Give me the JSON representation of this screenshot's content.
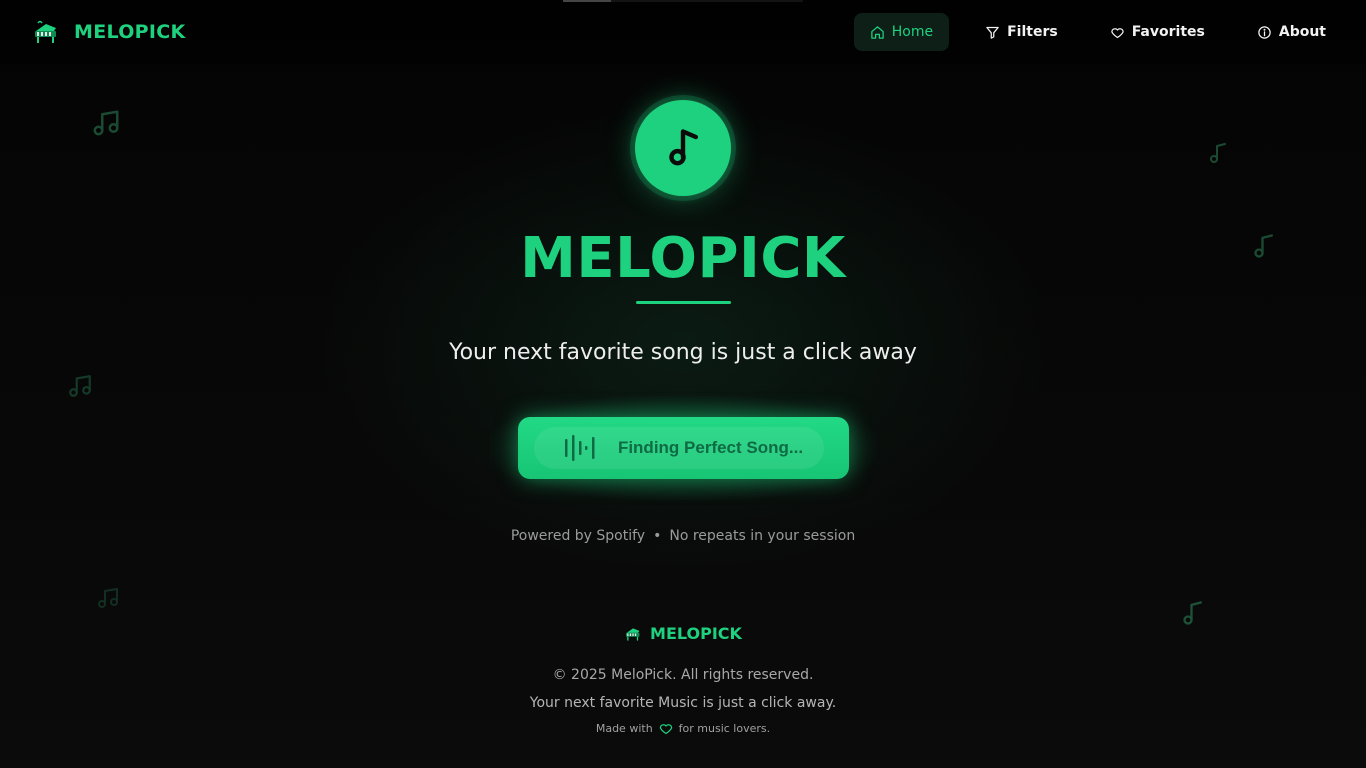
{
  "colors": {
    "accent": "#1ed17e",
    "background": "#050505",
    "button_text": "#0f6b43"
  },
  "top_progress": 0.2,
  "navbar": {
    "brand": "MELOPICK",
    "brand_icon": "piano-logo-icon",
    "items": [
      {
        "label": "Home",
        "icon": "home-icon",
        "active": true
      },
      {
        "label": "Filters",
        "icon": "filter-icon",
        "active": false
      },
      {
        "label": "Favorites",
        "icon": "heart-icon",
        "active": false
      },
      {
        "label": "About",
        "icon": "info-icon",
        "active": false
      }
    ]
  },
  "hero": {
    "icon": "music-note-icon",
    "title": "MELOPICK",
    "tagline": "Your next favorite song is just a click away",
    "button_label": "Finding Perfect Song...",
    "button_icon": "audio-wave-icon",
    "meta_left": "Powered by Spotify",
    "meta_sep": "•",
    "meta_right": "No repeats in your session"
  },
  "footer": {
    "brand": "MELOPICK",
    "copyright": "© 2025 MeloPick. All rights reserved.",
    "tagline": "Your next favorite Music is just a click away.",
    "made_prefix": "Made with",
    "made_suffix": "for music lovers."
  }
}
